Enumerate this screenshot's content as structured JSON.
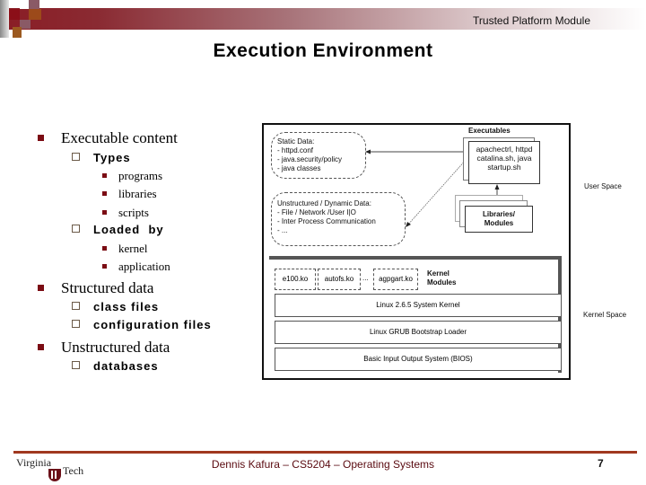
{
  "header": {
    "top_label": "Trusted Platform Module",
    "title": "Execution Environment"
  },
  "outline": [
    {
      "level": 1,
      "text": "Executable content"
    },
    {
      "level": 2,
      "text": "Types"
    },
    {
      "level": 3,
      "text": "programs"
    },
    {
      "level": 3,
      "text": "libraries"
    },
    {
      "level": 3,
      "text": "scripts"
    },
    {
      "level": 2,
      "text": "Loaded  by"
    },
    {
      "level": 3,
      "text": "kernel"
    },
    {
      "level": 3,
      "text": "application"
    },
    {
      "level": 1,
      "text": "Structured data"
    },
    {
      "level": 2,
      "text": "class files"
    },
    {
      "level": 2,
      "text": "configuration files"
    },
    {
      "level": 1,
      "text": "Unstructured data"
    },
    {
      "level": 2,
      "text": "databases"
    }
  ],
  "diagram": {
    "static_data": {
      "title": "Static Data:",
      "items": [
        "- httpd.conf",
        "-  java.security/policy",
        "-  java classes"
      ]
    },
    "dynamic_data": {
      "title": "Unstructured / Dynamic Data:",
      "items": [
        "- File / Network /User I|O",
        "- Inter Process Communication",
        "- ..."
      ]
    },
    "executables": {
      "label": "Executables",
      "lines": [
        "apachectrl, httpd",
        "catalina.sh, java",
        "startup.sh"
      ]
    },
    "libraries": {
      "lines": [
        "Libraries/",
        "Modules"
      ]
    },
    "kernel_modules": {
      "items": [
        "e100.ko",
        "autofs.ko",
        "agpgart.ko"
      ],
      "ellipsis": "...",
      "label_lines": [
        "Kernel",
        "Modules"
      ]
    },
    "layers": [
      "Linux 2.6.5 System Kernel",
      "Linux GRUB Bootstrap Loader",
      "Basic Input Output System (BIOS)"
    ],
    "user_space_label": "User Space",
    "kernel_space_label": "Kernel Space"
  },
  "footer": {
    "logo_line1": "Virginia",
    "logo_line2": "Tech",
    "text": "Dennis Kafura – CS5204 – Operating Systems",
    "page_number": "7"
  },
  "colors": {
    "accent": "#7b0c14",
    "footer_rule": "#a0381f"
  }
}
